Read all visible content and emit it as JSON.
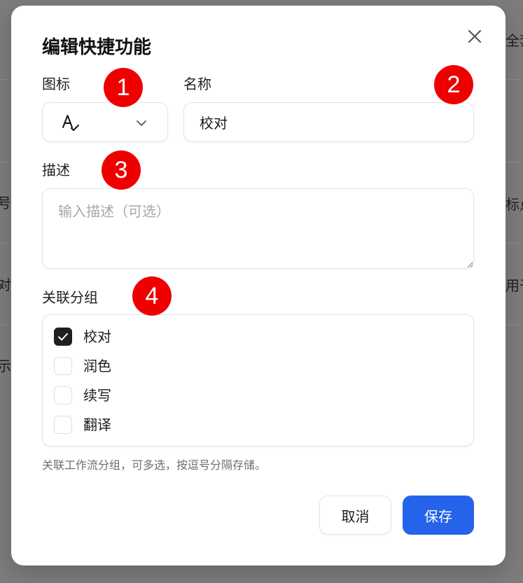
{
  "colors": {
    "accent": "#2563eb",
    "badge": "#ee0000",
    "overlay": "#7b7b7b",
    "checkbox_checked": "#1f1f1f"
  },
  "background": {
    "texts": [
      "全套",
      "号",
      "标点",
      "对",
      "用于",
      "示"
    ]
  },
  "dialog": {
    "title": "编辑快捷功能",
    "close_icon": "close-icon",
    "icon_field": {
      "label": "图标",
      "selected_icon": "spell-check-icon",
      "dropdown_icon": "chevron-down-icon"
    },
    "name_field": {
      "label": "名称",
      "value": "校对"
    },
    "description_field": {
      "label": "描述",
      "placeholder": "输入描述（可选）",
      "value": ""
    },
    "groups_field": {
      "label": "关联分组",
      "options": [
        {
          "label": "校对",
          "checked": true
        },
        {
          "label": "润色",
          "checked": false
        },
        {
          "label": "续写",
          "checked": false
        },
        {
          "label": "翻译",
          "checked": false
        }
      ],
      "hint": "关联工作流分组，可多选，按逗号分隔存储。"
    },
    "buttons": {
      "cancel": "取消",
      "save": "保存"
    }
  },
  "annotations": [
    "1",
    "2",
    "3",
    "4"
  ]
}
